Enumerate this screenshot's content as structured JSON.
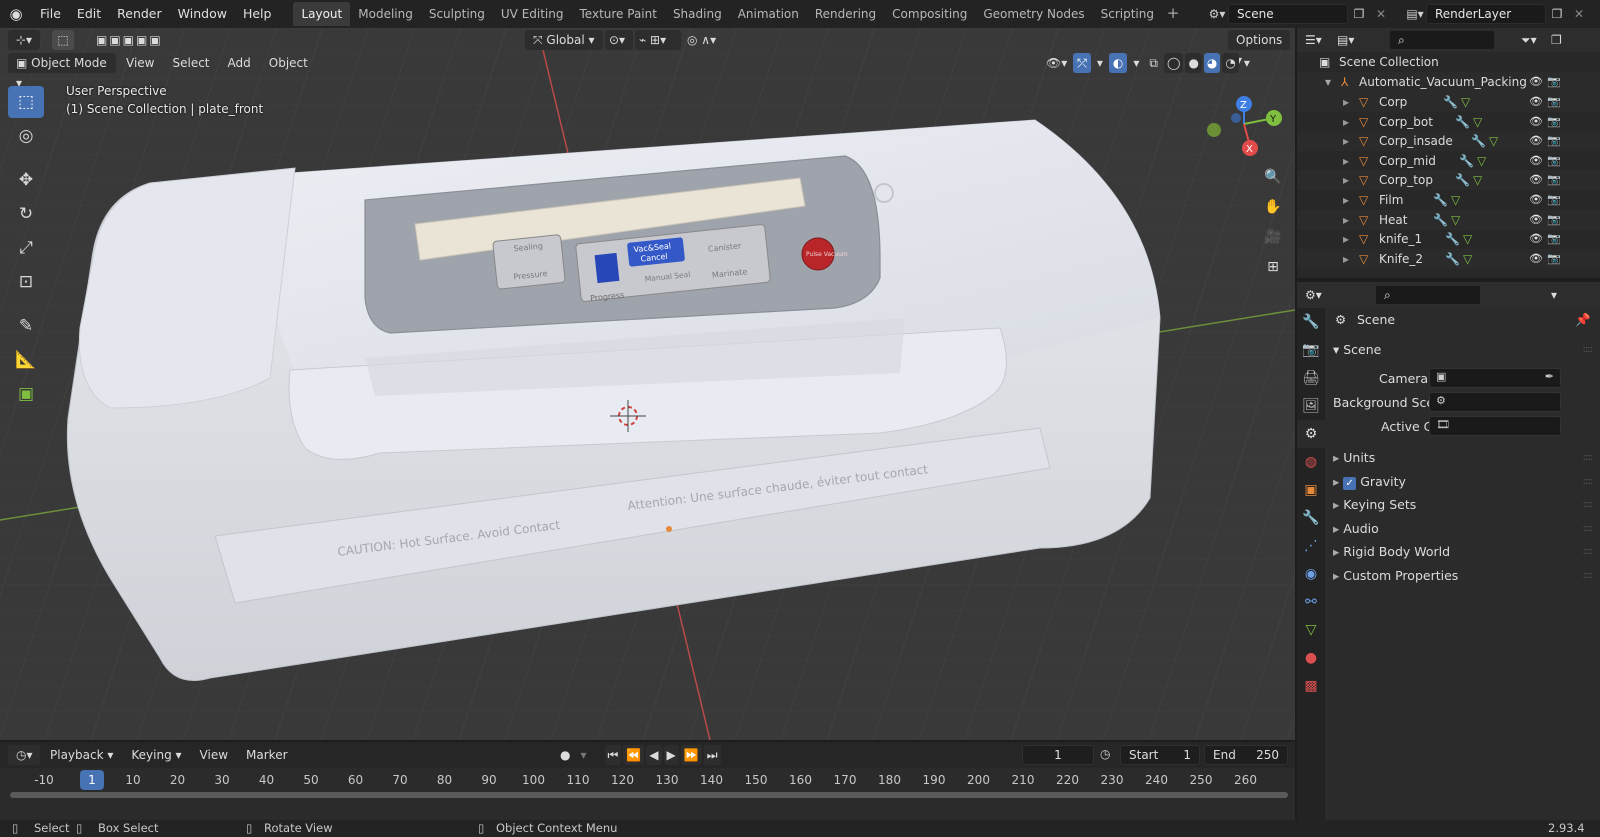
{
  "topbar": {
    "menus": [
      "File",
      "Edit",
      "Render",
      "Window",
      "Help"
    ],
    "workspaces": [
      "Layout",
      "Modeling",
      "Sculpting",
      "UV Editing",
      "Texture Paint",
      "Shading",
      "Animation",
      "Rendering",
      "Compositing",
      "Geometry Nodes",
      "Scripting"
    ],
    "active_workspace": "Layout",
    "scene_name": "Scene",
    "view_layer": "RenderLayer"
  },
  "viewport": {
    "transform_orientation": "Global",
    "options_label": "Options",
    "mode": "Object Mode",
    "menus": [
      "View",
      "Select",
      "Add",
      "Object"
    ],
    "perspective_label": "User Perspective",
    "context_label": "(1) Scene Collection | plate_front",
    "gizmo_axes": {
      "x": "X",
      "y": "Y",
      "z": "Z"
    },
    "model_text": {
      "caution_left": "CAUTION: Hot Surface. Avoid Contact",
      "caution_right": "Attention: Une surface chaude, éviter tout contact",
      "btn_vac_seal": "Vac&Seal",
      "btn_cancel": "Cancel",
      "btn_manual_seal": "Manual Seal",
      "btn_canister": "Canister",
      "btn_marinate": "Marinate",
      "btn_pulse": "Pulse Vacuum",
      "btn_sealing": "Sealing",
      "btn_pressure": "Pressure",
      "display_label": "Progress"
    }
  },
  "timeline": {
    "menus": [
      "Playback",
      "Keying",
      "View",
      "Marker"
    ],
    "current_frame": "1",
    "start_label": "Start",
    "start_value": "1",
    "end_label": "End",
    "end_value": "250",
    "ruler_ticks": [
      "-10",
      "1",
      "10",
      "20",
      "30",
      "40",
      "50",
      "60",
      "70",
      "80",
      "90",
      "100",
      "110",
      "120",
      "130",
      "140",
      "150",
      "160",
      "170",
      "180",
      "190",
      "200",
      "210",
      "220",
      "230",
      "240",
      "250",
      "260"
    ]
  },
  "statusbar": {
    "select": "Select",
    "box_select": "Box Select",
    "rotate_view": "Rotate View",
    "context_menu": "Object Context Menu",
    "version": "2.93.4"
  },
  "outliner": {
    "root": "Scene Collection",
    "collection": "Automatic_Vacuum_Packing",
    "objects": [
      "Corp",
      "Corp_bot",
      "Corp_insade",
      "Corp_mid",
      "Corp_top",
      "Film",
      "Heat",
      "knife_1",
      "Knife_2"
    ]
  },
  "properties": {
    "context_title": "Scene",
    "panel_title": "Scene",
    "camera_label": "Camera",
    "background_label": "Background Sce...",
    "active_clip_label": "Active Clip",
    "subpanels": [
      "Units",
      "Gravity",
      "Keying Sets",
      "Audio",
      "Rigid Body World",
      "Custom Properties"
    ],
    "gravity_checked": true
  },
  "colors": {
    "accent": "#4772b3",
    "axis_x": "#e34b4b",
    "axis_y": "#7fbf3f",
    "axis_z": "#3f7fe3",
    "object_orange": "#e6893a"
  }
}
